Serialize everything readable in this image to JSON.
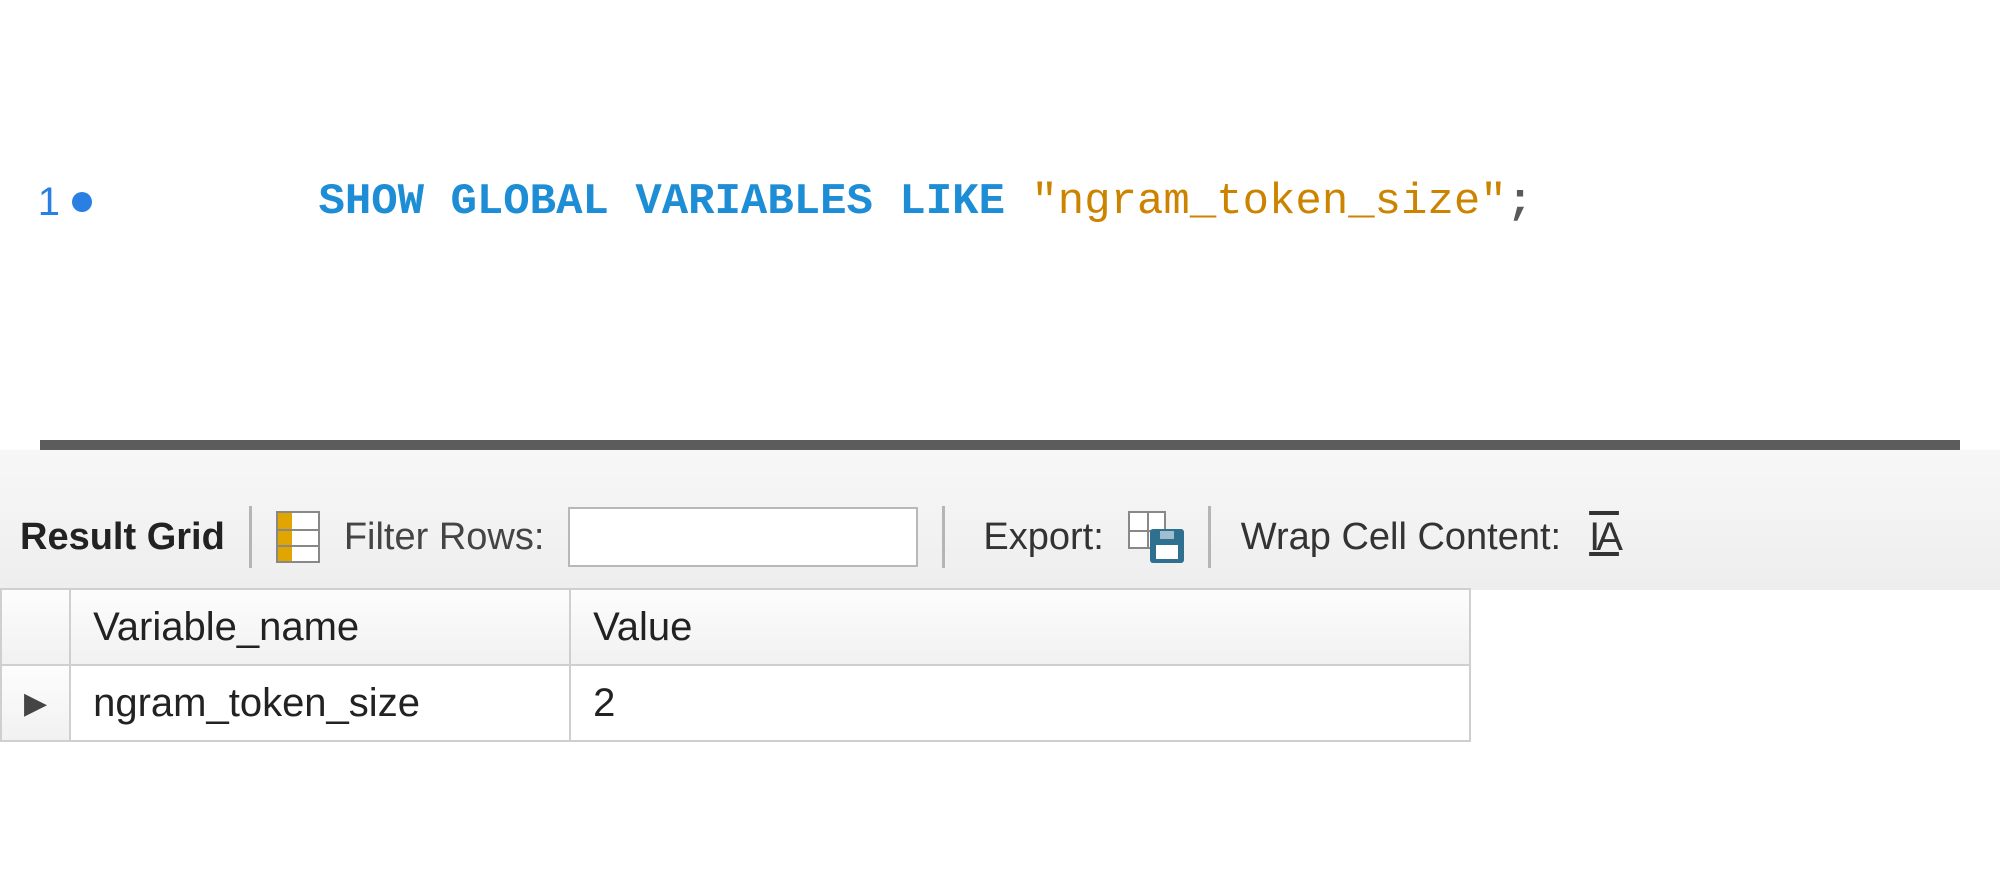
{
  "editor": {
    "line_number": "1",
    "sql_tokens": {
      "kw1": "SHOW",
      "kw2": "GLOBAL",
      "kw3": "VARIABLES",
      "kw4": "LIKE",
      "str": "\"ngram_token_size\"",
      "punct": ";"
    }
  },
  "toolbar": {
    "result_grid_label": "Result Grid",
    "filter_label": "Filter Rows:",
    "filter_value": "",
    "export_label": "Export:",
    "wrap_label": "Wrap Cell Content:",
    "wrap_icon_text": "IA"
  },
  "table": {
    "headers": {
      "variable_name": "Variable_name",
      "value": "Value"
    },
    "row_indicator": "▶",
    "rows": [
      {
        "variable_name": "ngram_token_size",
        "value": "2"
      }
    ]
  }
}
